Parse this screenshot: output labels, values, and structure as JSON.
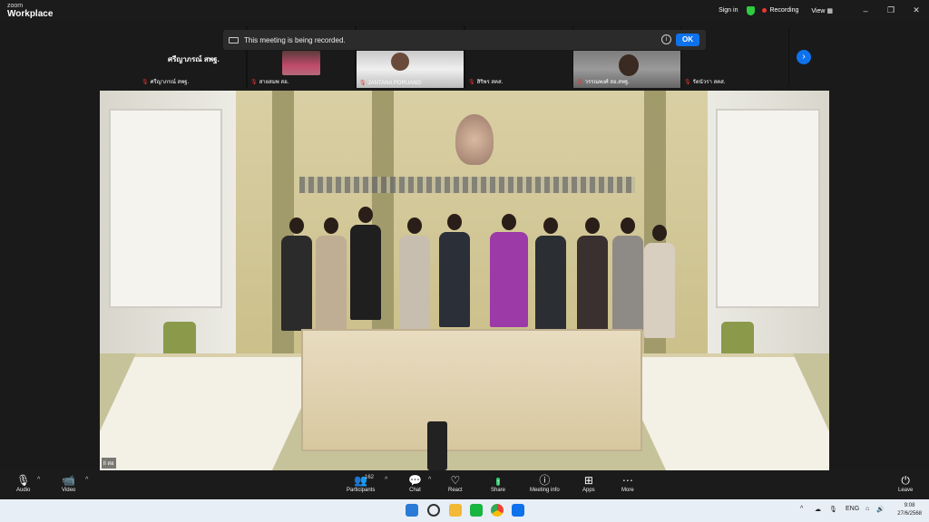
{
  "app": {
    "brand_small": "zoom",
    "brand_title": "Workplace"
  },
  "titlebar": {
    "sign_in": "Sign in",
    "recording": "Recording",
    "view": "View",
    "minimize": "–",
    "maximize": "❐",
    "close": "✕"
  },
  "banner": {
    "message": "This meeting is being recorded.",
    "info": "i",
    "ok": "OK"
  },
  "participants": [
    {
      "name": "ศรีญาภรณ์ สพฐ.",
      "big_name": "ศรีญาภรณ์ สพฐ."
    },
    {
      "name": "สายสมพ สอ."
    },
    {
      "name": "JANTANA PORUANG"
    },
    {
      "name": "สิริพร สคส."
    },
    {
      "name": "วรรณพงศ์ สอ.สพฐ."
    },
    {
      "name": "รัตนัวรา สคส."
    }
  ],
  "main_video": {
    "self_label": "ll สอ"
  },
  "toolbar": {
    "audio": "Audio",
    "video": "Video",
    "participants": "Participants",
    "participants_count": "162",
    "chat": "Chat",
    "react": "React",
    "share": "Share",
    "meeting_info": "Meeting info",
    "apps": "Apps",
    "more": "More",
    "leave": "Leave"
  },
  "taskbar": {
    "lang": "ENG",
    "time": "9:08",
    "date": "27/6/2568"
  },
  "colors": {
    "accent": "#0e72ed",
    "recording": "#e53935",
    "share": "#2ecc71"
  }
}
